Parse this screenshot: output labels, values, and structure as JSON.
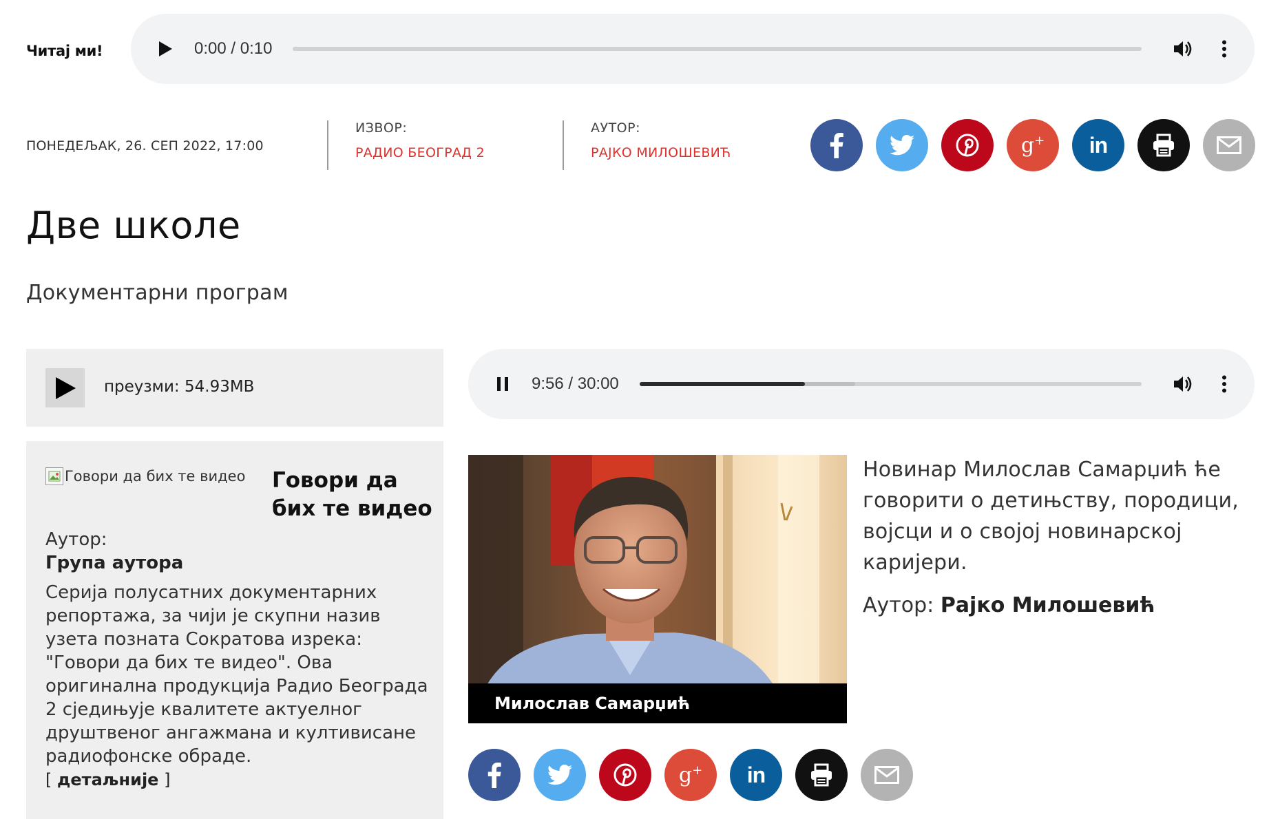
{
  "read_to_me": {
    "label": "Читај ми!",
    "time": "0:00 / 0:10",
    "progress": 0.0
  },
  "meta": {
    "date": "ПОНЕДЕЉАК, 26. СЕП 2022, 17:00",
    "source_label": "ИЗВОР:",
    "source_value": "РАДИО БЕОГРАД 2",
    "author_label": "АУТОР:",
    "author_value": "РАЈКО МИЛОШЕВИЋ"
  },
  "share_icons": [
    "facebook-icon",
    "twitter-icon",
    "pinterest-icon",
    "google-plus-icon",
    "linkedin-icon",
    "print-icon",
    "email-icon"
  ],
  "colors": {
    "accent_red": "#e3302b",
    "facebook": "#3b5998",
    "twitter": "#55acee",
    "pinterest": "#bd081c",
    "google_plus": "#dd4b39",
    "linkedin": "#0b5e9c",
    "print": "#111111",
    "email": "#b3b3b3"
  },
  "article": {
    "title": "Две школе",
    "category": "Документарни програм",
    "download_label": "преузми: 54.93MB",
    "player_time": "9:56 / 30:00",
    "player_progress": 0.33,
    "player_buffered": 0.43,
    "photo_caption": "Милослав Самарџић",
    "body": "Новинар Милослав Самарџић ће говорити о детињству, породици, војсци и о својој новинарској каријери.",
    "author_label": "Аутор:",
    "author_name": "Рајко Милошевић"
  },
  "show": {
    "image_alt": "Говори да бих те видео",
    "title": "Говори да бих те видео",
    "author_label": "Аутор:",
    "author_name": "Група аутора",
    "description": "Серија полусатних документарних репортажа, за чији је скупни назив узета позната Сократова изрека: \"Говори да бих те видео\". Ова оригинална продукција Радио Београда 2 сједињује квалитете актуелног друштвеног ангажмана и култивисане радиофонске обраде.",
    "more_open": "[ ",
    "more_label": "детаљније",
    "more_close": " ]"
  }
}
